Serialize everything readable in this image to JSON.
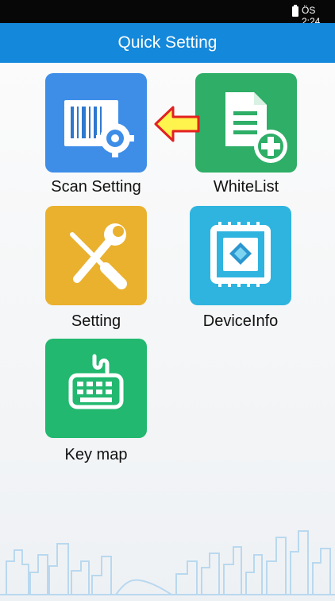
{
  "status_bar": {
    "time": "ÖS 2:24"
  },
  "app_bar": {
    "title": "Quick Setting"
  },
  "tiles": [
    {
      "label": "Scan Setting",
      "color": "#3e8ee8"
    },
    {
      "label": "WhiteList",
      "color": "#2eae67"
    },
    {
      "label": "Setting",
      "color": "#eab12e"
    },
    {
      "label": "DeviceInfo",
      "color": "#2fb4df"
    },
    {
      "label": "Key map",
      "color": "#22b86f"
    }
  ],
  "icons": {
    "scan": "barcode-gear-icon",
    "whitelist": "document-add-icon",
    "setting": "wrench-screwdriver-icon",
    "deviceinfo": "chip-icon",
    "keymap": "keyboard-icon",
    "arrow": "left-arrow-icon"
  }
}
